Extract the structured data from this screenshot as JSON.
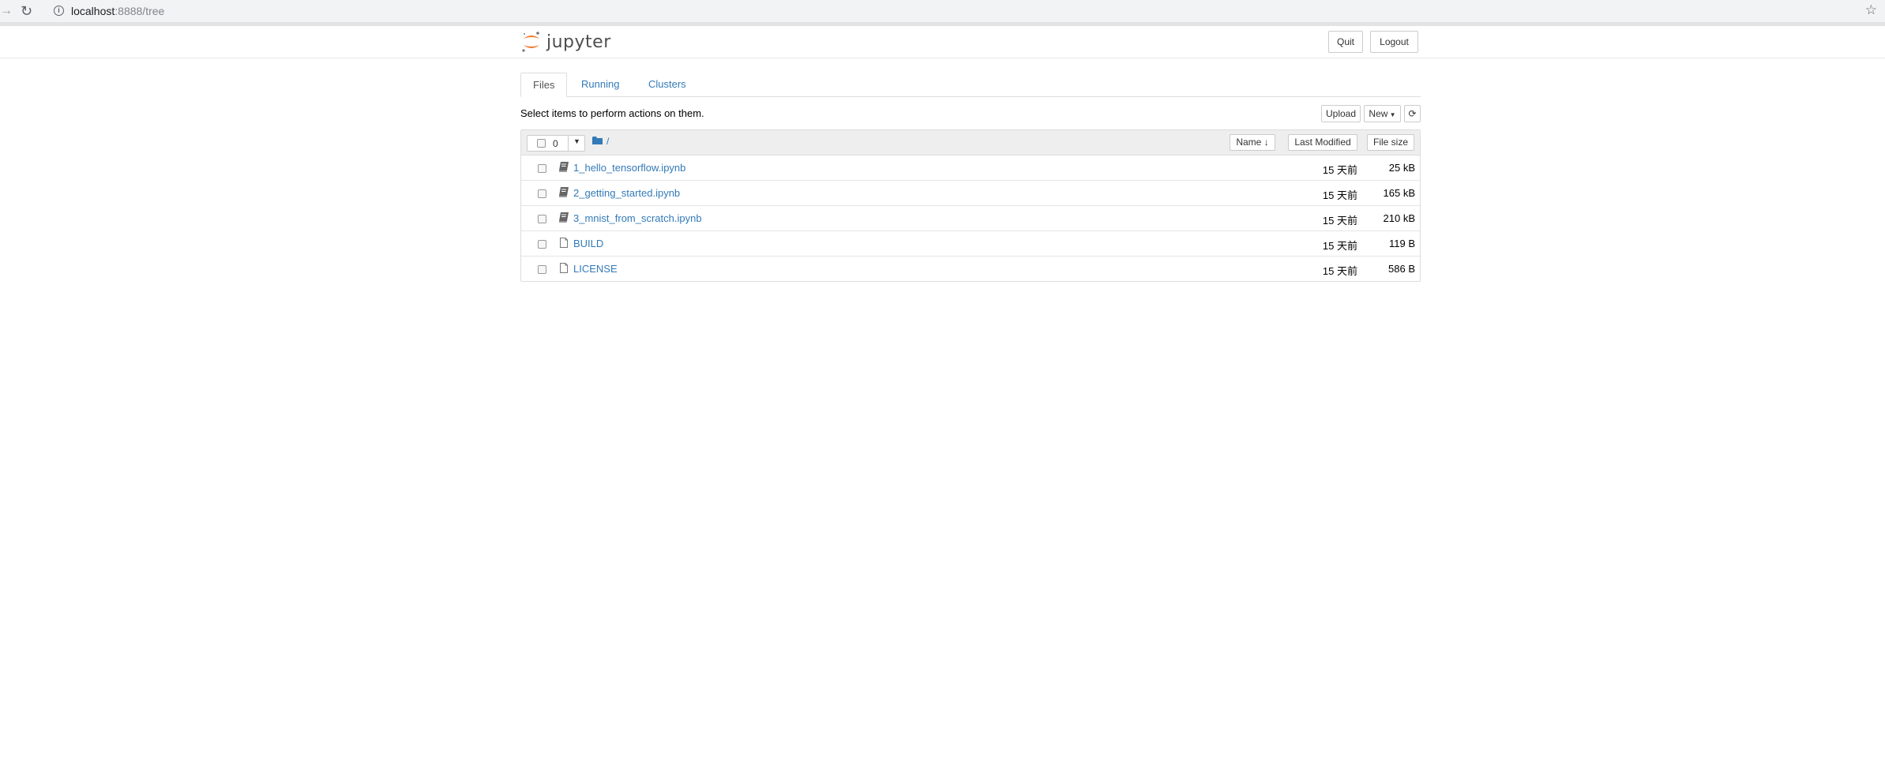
{
  "browser": {
    "url_host": "localhost",
    "url_path": ":8888/tree"
  },
  "header": {
    "logo_text": "jupyter",
    "quit_label": "Quit",
    "logout_label": "Logout"
  },
  "tabs": [
    {
      "label": "Files",
      "active": true
    },
    {
      "label": "Running",
      "active": false
    },
    {
      "label": "Clusters",
      "active": false
    }
  ],
  "toolbar": {
    "instruction": "Select items to perform actions on them.",
    "upload_label": "Upload",
    "new_label": "New",
    "refresh_icon": "refresh-icon"
  },
  "list_header": {
    "selected_count": "0",
    "breadcrumb_root": "/",
    "sort_name_label": "Name",
    "sort_modified_label": "Last Modified",
    "sort_size_label": "File size"
  },
  "files": [
    {
      "name": "1_hello_tensorflow.ipynb",
      "type": "notebook",
      "modified": "15 天前",
      "size": "25 kB"
    },
    {
      "name": "2_getting_started.ipynb",
      "type": "notebook",
      "modified": "15 天前",
      "size": "165 kB"
    },
    {
      "name": "3_mnist_from_scratch.ipynb",
      "type": "notebook",
      "modified": "15 天前",
      "size": "210 kB"
    },
    {
      "name": "BUILD",
      "type": "file",
      "modified": "15 天前",
      "size": "119 B"
    },
    {
      "name": "LICENSE",
      "type": "file",
      "modified": "15 天前",
      "size": "586 B"
    }
  ],
  "colors": {
    "link": "#337ab7",
    "jupyter_orange": "#f37726"
  }
}
